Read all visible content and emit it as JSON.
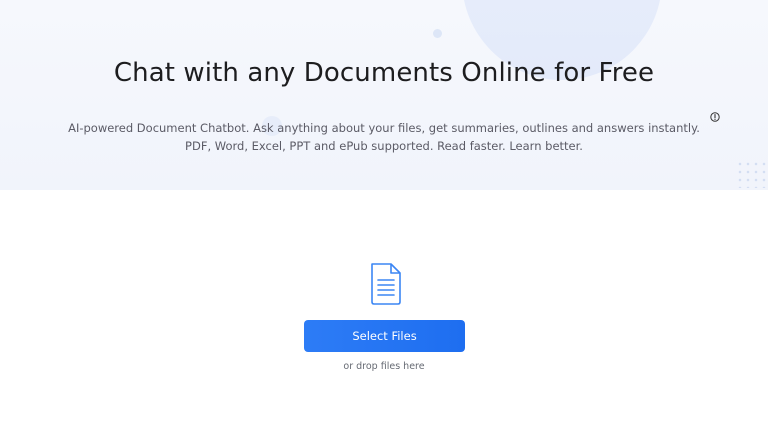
{
  "hero": {
    "title": "Chat with any Documents Online for Free",
    "subtitle_line1": "AI-powered Document Chatbot. Ask anything about your files, get summaries, outlines and answers instantly.",
    "subtitle_line2": "PDF, Word, Excel, PPT and ePub supported. Read faster. Learn better."
  },
  "upload": {
    "button_label": "Select Files",
    "drop_hint": "or drop files here"
  },
  "icons": {
    "info": "info-icon",
    "document": "document-icon"
  },
  "colors": {
    "accent": "#1e6ef0",
    "hero_background": "#f4f7fd",
    "panel_background": "#ffffff"
  }
}
